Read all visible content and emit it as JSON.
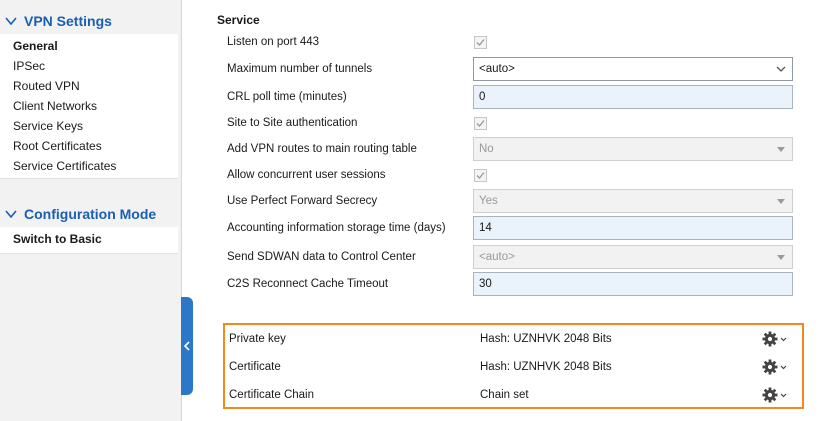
{
  "sidebar": {
    "sections": [
      {
        "title": "VPN Settings",
        "items": [
          {
            "label": "General"
          },
          {
            "label": "IPSec"
          },
          {
            "label": "Routed VPN"
          },
          {
            "label": "Client Networks"
          },
          {
            "label": "Service Keys"
          },
          {
            "label": "Root Certificates"
          },
          {
            "label": "Service Certificates"
          }
        ]
      },
      {
        "title": "Configuration Mode",
        "items": [
          {
            "label": "Switch to Basic"
          }
        ]
      }
    ],
    "collapse_icon": "chevron-left-icon"
  },
  "service": {
    "title": "Service",
    "rows": [
      {
        "label": "Listen on port 443",
        "type": "checkbox",
        "checked": true,
        "enabled": false
      },
      {
        "label": "Maximum number of tunnels",
        "type": "select",
        "value": "<auto>",
        "enabled": true
      },
      {
        "label": "CRL poll time (minutes)",
        "type": "text",
        "value": "0"
      },
      {
        "label": "Site to Site authentication",
        "type": "checkbox",
        "checked": true,
        "enabled": false
      },
      {
        "label": "Add VPN routes to main routing table",
        "type": "select",
        "value": "No",
        "enabled": false
      },
      {
        "label": "Allow concurrent user sessions",
        "type": "checkbox",
        "checked": true,
        "enabled": false
      },
      {
        "label": "Use Perfect Forward Secrecy",
        "type": "select",
        "value": "Yes",
        "enabled": false
      },
      {
        "label": "Accounting information storage time (days)",
        "type": "text",
        "value": "14"
      },
      {
        "label": "Send SDWAN data to Control Center",
        "type": "select",
        "value": "<auto>",
        "enabled": false
      },
      {
        "label": "C2S Reconnect Cache Timeout",
        "type": "text",
        "value": "30"
      }
    ]
  },
  "certificates": {
    "highlight_color": "#f08a1c",
    "rows": [
      {
        "label": "Private key",
        "value": "Hash: UZNHVK 2048 Bits",
        "icon": "gear-icon"
      },
      {
        "label": "Certificate",
        "value": "Hash: UZNHVK 2048 Bits",
        "icon": "gear-icon"
      },
      {
        "label": "Certificate Chain",
        "value": "Chain set",
        "icon": "gear-icon"
      }
    ]
  },
  "colors": {
    "accent": "#1a5fb4",
    "collapse_tab": "#2b78c8",
    "input_bg": "#eaf2fb"
  }
}
